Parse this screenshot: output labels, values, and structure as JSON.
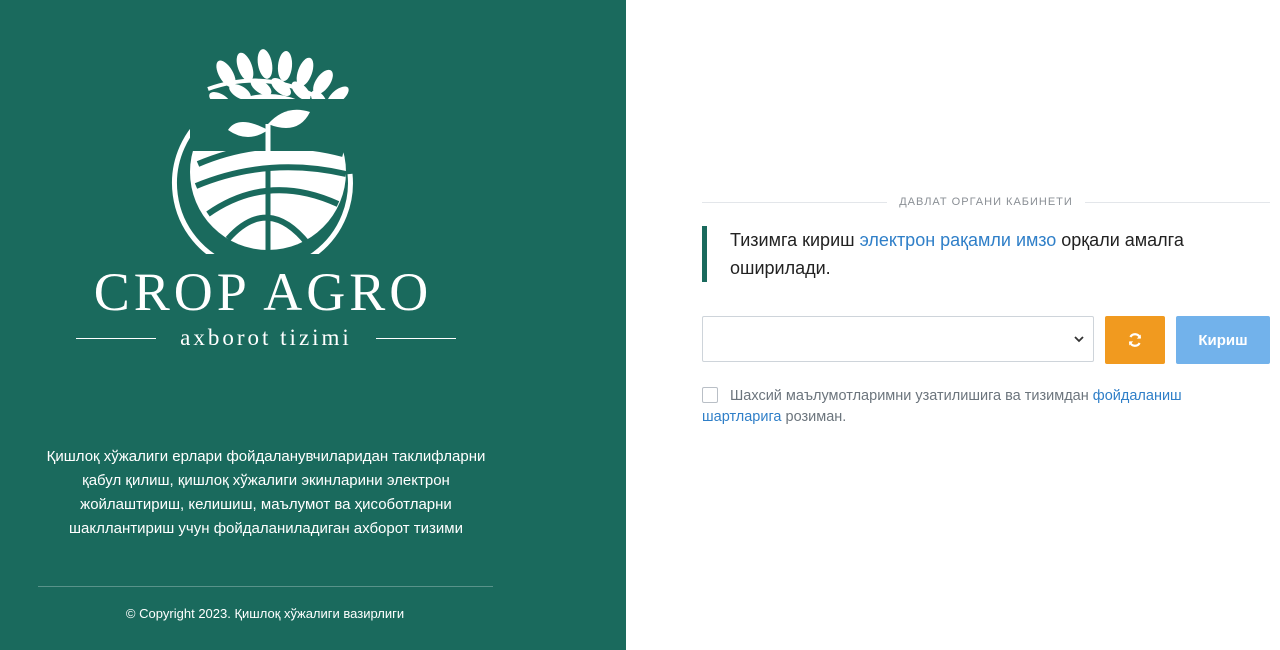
{
  "brand": {
    "title": "CROP AGRO",
    "subtitle": "axborot tizimi",
    "emblem_icon": "wheat-sprout-field-emblem-icon",
    "panel_color": "#1a6a5d"
  },
  "description": "Қишлоқ хўжалиги ерлари фойдаланувчиларидан таклифларни қабул қилиш, қишлоқ хўжалиги экинларини электрон жойлаштириш, келишиш, маълумот ва ҳисоботларни шакллантириш учун фойдаланиладиган ахборот тизими",
  "copyright": "© Copyright 2023. Қишлоқ хўжалиги вазирлиги",
  "login": {
    "section_title": "ДАВЛАТ ОРГАНИ КАБИНЕТИ",
    "notice_before": "Тизимга кириш ",
    "notice_link": "электрон рақамли имзо",
    "notice_after": " орқали амалга оширилади.",
    "certificate_select_value": "",
    "refresh_icon": "refresh-icon",
    "submit_label": "Кириш",
    "consent_before": "Шахсий маълумотларимни узатилишига ва тизимдан ",
    "consent_link": "фойдаланиш шартларига",
    "consent_after": " розиман.",
    "consent_checked": false
  },
  "colors": {
    "accent": "#1a6a5d",
    "link": "#2f7fc8",
    "refresh_button": "#f19a1f",
    "submit_button": "#72b2eb"
  }
}
